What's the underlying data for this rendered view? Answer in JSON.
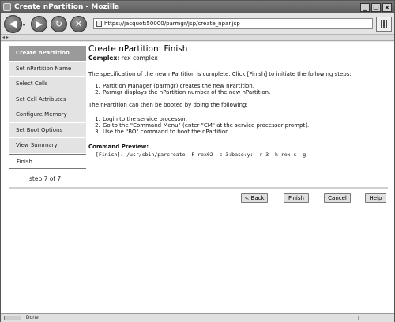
{
  "window": {
    "title": "Create nPartition - Mozilla",
    "controls": [
      "_",
      "□",
      "×"
    ]
  },
  "toolbar": {
    "url": "https://jacquot:50000/parmgr/jsp/create_npar.jsp"
  },
  "sidebar": {
    "items": [
      {
        "label": "Create nPartition"
      },
      {
        "label": "Set nPartition Name"
      },
      {
        "label": "Select Cells"
      },
      {
        "label": "Set Cell Attributes"
      },
      {
        "label": "Configure Memory"
      },
      {
        "label": "Set Boot Options"
      },
      {
        "label": "View Summary"
      },
      {
        "label": "Finish"
      }
    ],
    "step": "step 7 of 7"
  },
  "main": {
    "title": "Create nPartition: Finish",
    "complex_label": "Complex:",
    "complex_value": "rex complex",
    "intro": "The specification of the new nPartition is complete. Click [Finish] to initiate the following steps:",
    "steps1": [
      "Partition Manager (parmgr) creates the new nPartition.",
      "Parmgr displays the nPartition number of the new nPartition."
    ],
    "boot_intro": "The nPartition can then be booted by doing the following:",
    "steps2": [
      "Login to the service processor.",
      "Go to the \"Command Menu\" (enter \"CM\" at the service processor prompt).",
      "Use the \"BO\" command to boot the nPartition."
    ],
    "preview_label": "Command Preview:",
    "preview_command": "[Finish]:  /usr/sbin/parcreate -P rex02 -c 3:base:y: -r 3 -h rex-s -g"
  },
  "buttons": {
    "back": "< Back",
    "finish": "Finish",
    "cancel": "Cancel",
    "help": "Help"
  },
  "status": {
    "text": "Done"
  }
}
